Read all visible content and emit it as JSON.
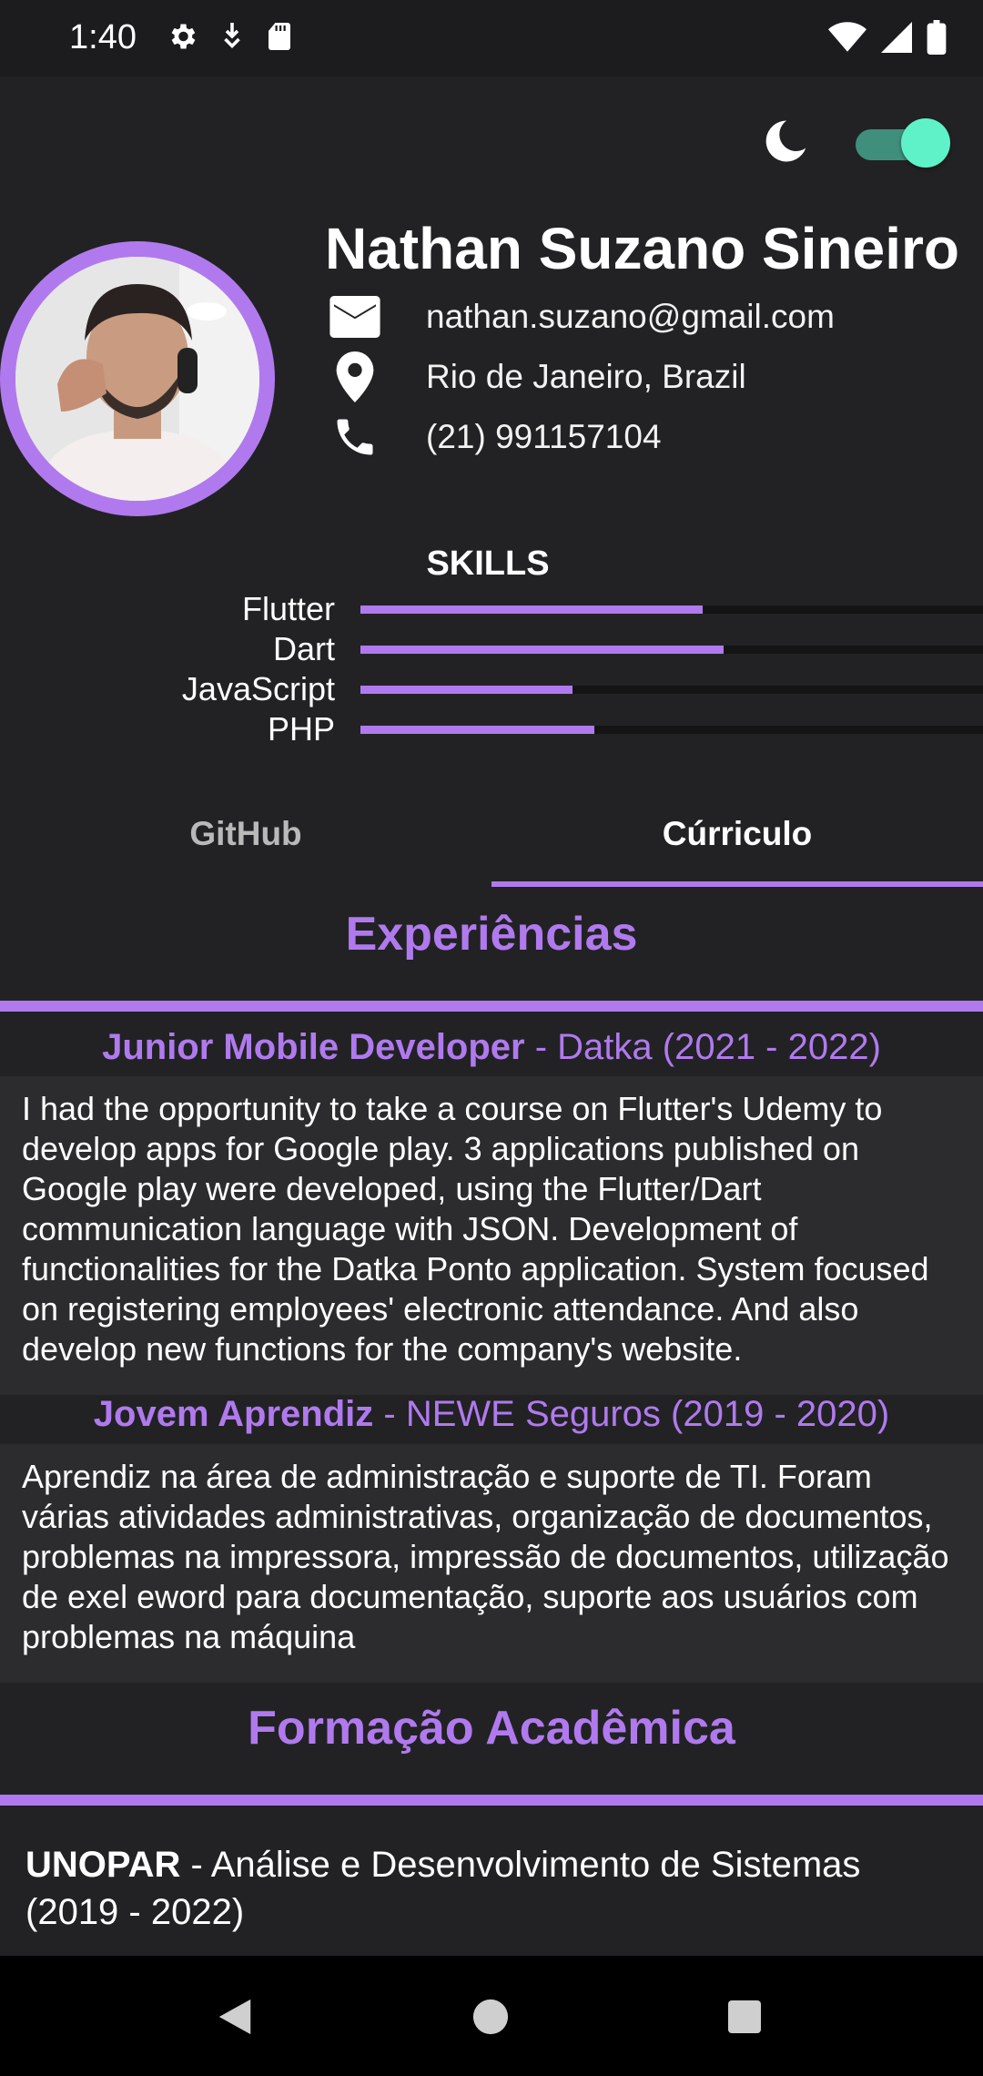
{
  "status_bar": {
    "time": "1:40",
    "left_icons": [
      "gear-icon",
      "download-icon",
      "sd-card-icon"
    ],
    "right_icons": [
      "wifi-icon",
      "signal-icon",
      "battery-icon"
    ]
  },
  "theme": {
    "icon": "moon-icon",
    "dark_mode_on": true,
    "accent": "#5ff2c8"
  },
  "profile": {
    "name": "Nathan Suzano Sineiro",
    "email": "nathan.suzano@gmail.com",
    "location": "Rio de Janeiro, Brazil",
    "phone": "(21) 991157104"
  },
  "skills": {
    "title": "SKILLS",
    "items": [
      {
        "label": "Flutter",
        "level": 0.55
      },
      {
        "label": "Dart",
        "level": 0.584
      },
      {
        "label": "JavaScript",
        "level": 0.34
      },
      {
        "label": "PHP",
        "level": 0.376
      }
    ]
  },
  "tabs": [
    {
      "label": "GitHub",
      "active": false
    },
    {
      "label": "Cúrriculo",
      "active": true
    }
  ],
  "experiences": {
    "title": "Experiências",
    "items": [
      {
        "role": "Junior Mobile Developer",
        "company": " - Datka (2021 - 2022)",
        "description": "I had the opportunity to take a course on Flutter's Udemy to develop apps for Google play. 3 applications published on Google play were developed, using the Flutter/Dart communication language with JSON. Development of functionalities for the Datka Ponto application. System focused on registering employees' electronic attendance. And also develop new functions for the company's website."
      },
      {
        "role": "Jovem Aprendiz",
        "company": " - NEWE Seguros (2019 - 2020)",
        "description": "Aprendiz na área de administração e suporte de TI. Foram várias atividades administrativas, organização de documentos, problemas na impressora, impressão de documentos, utilização de exel eword para documentação, suporte aos usuários com problemas na máquina"
      }
    ]
  },
  "education": {
    "title": "Formação Acadêmica",
    "items": [
      {
        "school": "UNOPAR",
        "course": " - Análise e Desenvolvimento de Sistemas (2019 - 2022)"
      }
    ]
  },
  "colors": {
    "accent": "#b07aee",
    "background": "#222224"
  }
}
